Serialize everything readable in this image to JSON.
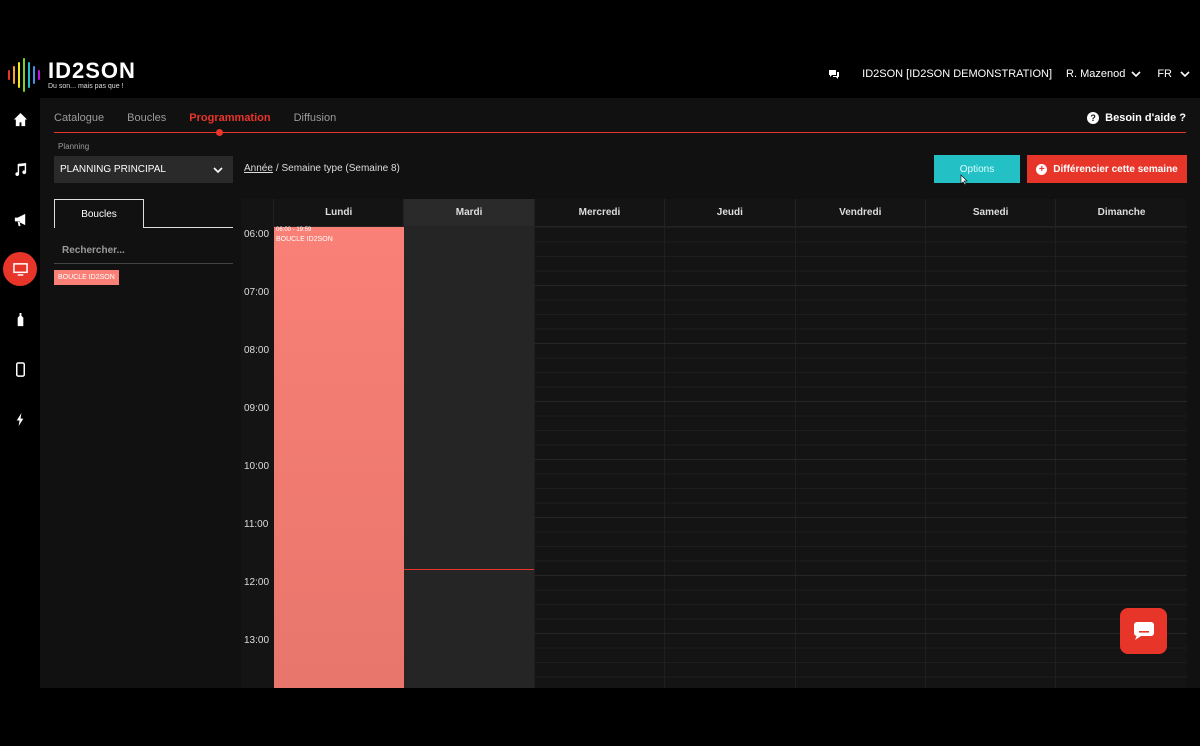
{
  "app": {
    "logo_name": "ID2SON",
    "logo_tagline": "Du son... mais pas que !",
    "colors": {
      "accent": "#e8352a",
      "options": "#23c0c6",
      "event": "#f98076"
    }
  },
  "header": {
    "organization": "ID2SON [ID2SON DEMONSTRATION]",
    "user": "R. Mazenod",
    "language": "FR"
  },
  "rail": {
    "items": [
      {
        "icon": "home-icon"
      },
      {
        "icon": "music-icon"
      },
      {
        "icon": "megaphone-icon"
      },
      {
        "icon": "monitor-icon",
        "active": true
      },
      {
        "icon": "bottle-icon"
      },
      {
        "icon": "phone-icon"
      },
      {
        "icon": "lightning-icon"
      }
    ]
  },
  "tabs": [
    {
      "label": "Catalogue"
    },
    {
      "label": "Boucles"
    },
    {
      "label": "Programmation",
      "active": true
    },
    {
      "label": "Diffusion"
    }
  ],
  "help": {
    "label": "Besoin d'aide ?"
  },
  "planning": {
    "label": "Planning",
    "selected": "PLANNING PRINCIPAL"
  },
  "breadcrumb": {
    "link": "Année",
    "separator": "/",
    "current": "Semaine type (Semaine 8)"
  },
  "buttons": {
    "options": "Options",
    "differentiate": "Différencier cette semaine"
  },
  "sidebar": {
    "tab": "Boucles",
    "search_placeholder": "Rechercher...",
    "loops": [
      "BOUCLE ID2SON"
    ]
  },
  "calendar": {
    "days": [
      "Lundi",
      "Mardi",
      "Mercredi",
      "Jeudi",
      "Vendredi",
      "Samedi",
      "Dimanche"
    ],
    "today_index": 1,
    "hours": [
      "06:00",
      "07:00",
      "08:00",
      "09:00",
      "10:00",
      "11:00",
      "12:00",
      "13:00"
    ],
    "event": {
      "day": "Lundi",
      "time": "06:00 - 19:59",
      "title": "BOUCLE ID2SON"
    }
  }
}
